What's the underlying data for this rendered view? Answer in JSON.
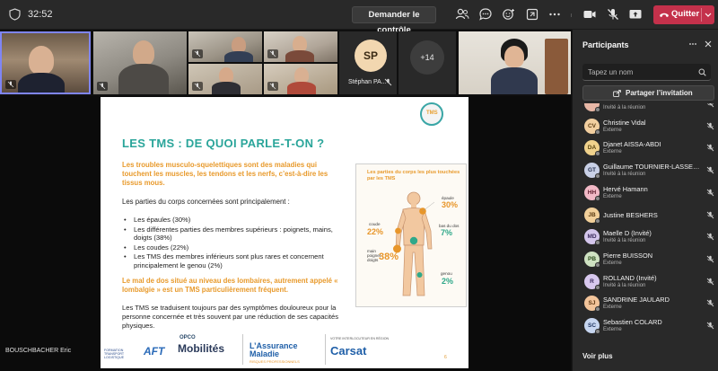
{
  "topbar": {
    "timer": "32:52",
    "request_control_label": "Demander le contrôle",
    "leave_label": "Quitter"
  },
  "videos": {
    "sp_initials": "SP",
    "sp_name": "Stéphan PA...",
    "more_count": "+14"
  },
  "presenter": "BOUSCHBACHER Eric",
  "slide": {
    "badge": "TMS",
    "title": "LES TMS : DE QUOI PARLE-T-ON ?",
    "intro": "Les troubles musculo-squelettiques sont des maladies qui touchent les muscles, les tendons et les nerfs, c’est-à-dire les tissus mous.",
    "parts_intro": "Les parties du corps concernées sont principalement :",
    "bullets": [
      "Les épaules (30%)",
      "Les différentes parties des membres supérieurs : poignets, mains, doigts (38%)",
      "Les coudes (22%)",
      "Les TMS des membres inférieurs sont plus rares et concernent principalement le genou (2%)"
    ],
    "lumbago": "Le mal de dos situé au niveau des lombaires, autrement appelé « lombalgie » est un TMS particulièrement fréquent.",
    "final": "Les TMS se traduisent toujours par des symptômes douloureux pour la personne concernée et très souvent par une réduction de ses capacités physiques.",
    "page_number": "6",
    "figure": {
      "title": "Les parties du corps les plus touchées par les TMS",
      "epaule_label": "épaule",
      "epaule_pct": "30%",
      "coude_label": "coude",
      "coude_pct": "22%",
      "dos_label": "bas du dos",
      "dos_pct": "7%",
      "poignet_label": "main poignet doigts",
      "poignet_pct": "38%",
      "genou_label": "genou",
      "genou_pct": "2%"
    },
    "logos": {
      "aft_small": "FORMATION TRANSPORT LOGISTIQUE",
      "aft": "AFT",
      "opco_small": "OPCO",
      "opco": "Mobilités",
      "am_line1": "L’Assurance",
      "am_line2": "Maladie",
      "am_sub": "RISQUES PROFESSIONNELS",
      "carsat_small": "VOTRE INTERLOCUTEUR EN RÉGION",
      "carsat": "Carsat"
    }
  },
  "panel": {
    "title": "Participants",
    "search_placeholder": "Tapez un nom",
    "share_label": "Partager l’invitation",
    "see_more": "Voir plus",
    "participants": [
      {
        "name": "",
        "initials": "",
        "status": "Invité à la réunion",
        "color": "#e8b7a6",
        "fg": "#5a2a1a"
      },
      {
        "name": "Christine Vidal",
        "initials": "CV",
        "status": "Externe",
        "color": "#f2cfa0",
        "fg": "#5a3a10"
      },
      {
        "name": "Djanet AISSA-ABDI",
        "initials": "DA",
        "status": "Externe",
        "color": "#f0d28c",
        "fg": "#5a4410"
      },
      {
        "name": "Guillaume TOURNIER-LASSERVE...",
        "initials": "GT",
        "status": "Invité à la réunion",
        "color": "#c9d0e6",
        "fg": "#26304e"
      },
      {
        "name": "Hervé Hamann",
        "initials": "HH",
        "status": "Externe",
        "color": "#f2b9c6",
        "fg": "#5c1a2a"
      },
      {
        "name": "Justine BESHERS",
        "initials": "JB",
        "status": "",
        "color": "#f2d09a",
        "fg": "#5a3a10"
      },
      {
        "name": "Maelle D (Invité)",
        "initials": "MD",
        "status": "Invité à la réunion",
        "color": "#d4c6ec",
        "fg": "#3a2a5c"
      },
      {
        "name": "Pierre BUISSON",
        "initials": "PB",
        "status": "Externe",
        "color": "#cfe2c2",
        "fg": "#2a4a1a"
      },
      {
        "name": "ROLLAND (Invité)",
        "initials": "R",
        "status": "Invité à la réunion",
        "color": "#d8c8ee",
        "fg": "#3a2a5c"
      },
      {
        "name": "SANDRINE JAULARD",
        "initials": "SJ",
        "status": "Externe",
        "color": "#f2c49a",
        "fg": "#5a3410"
      },
      {
        "name": "Sebastien COLARD",
        "initials": "SC",
        "status": "Externe",
        "color": "#c7d6f0",
        "fg": "#1e3460"
      }
    ]
  }
}
